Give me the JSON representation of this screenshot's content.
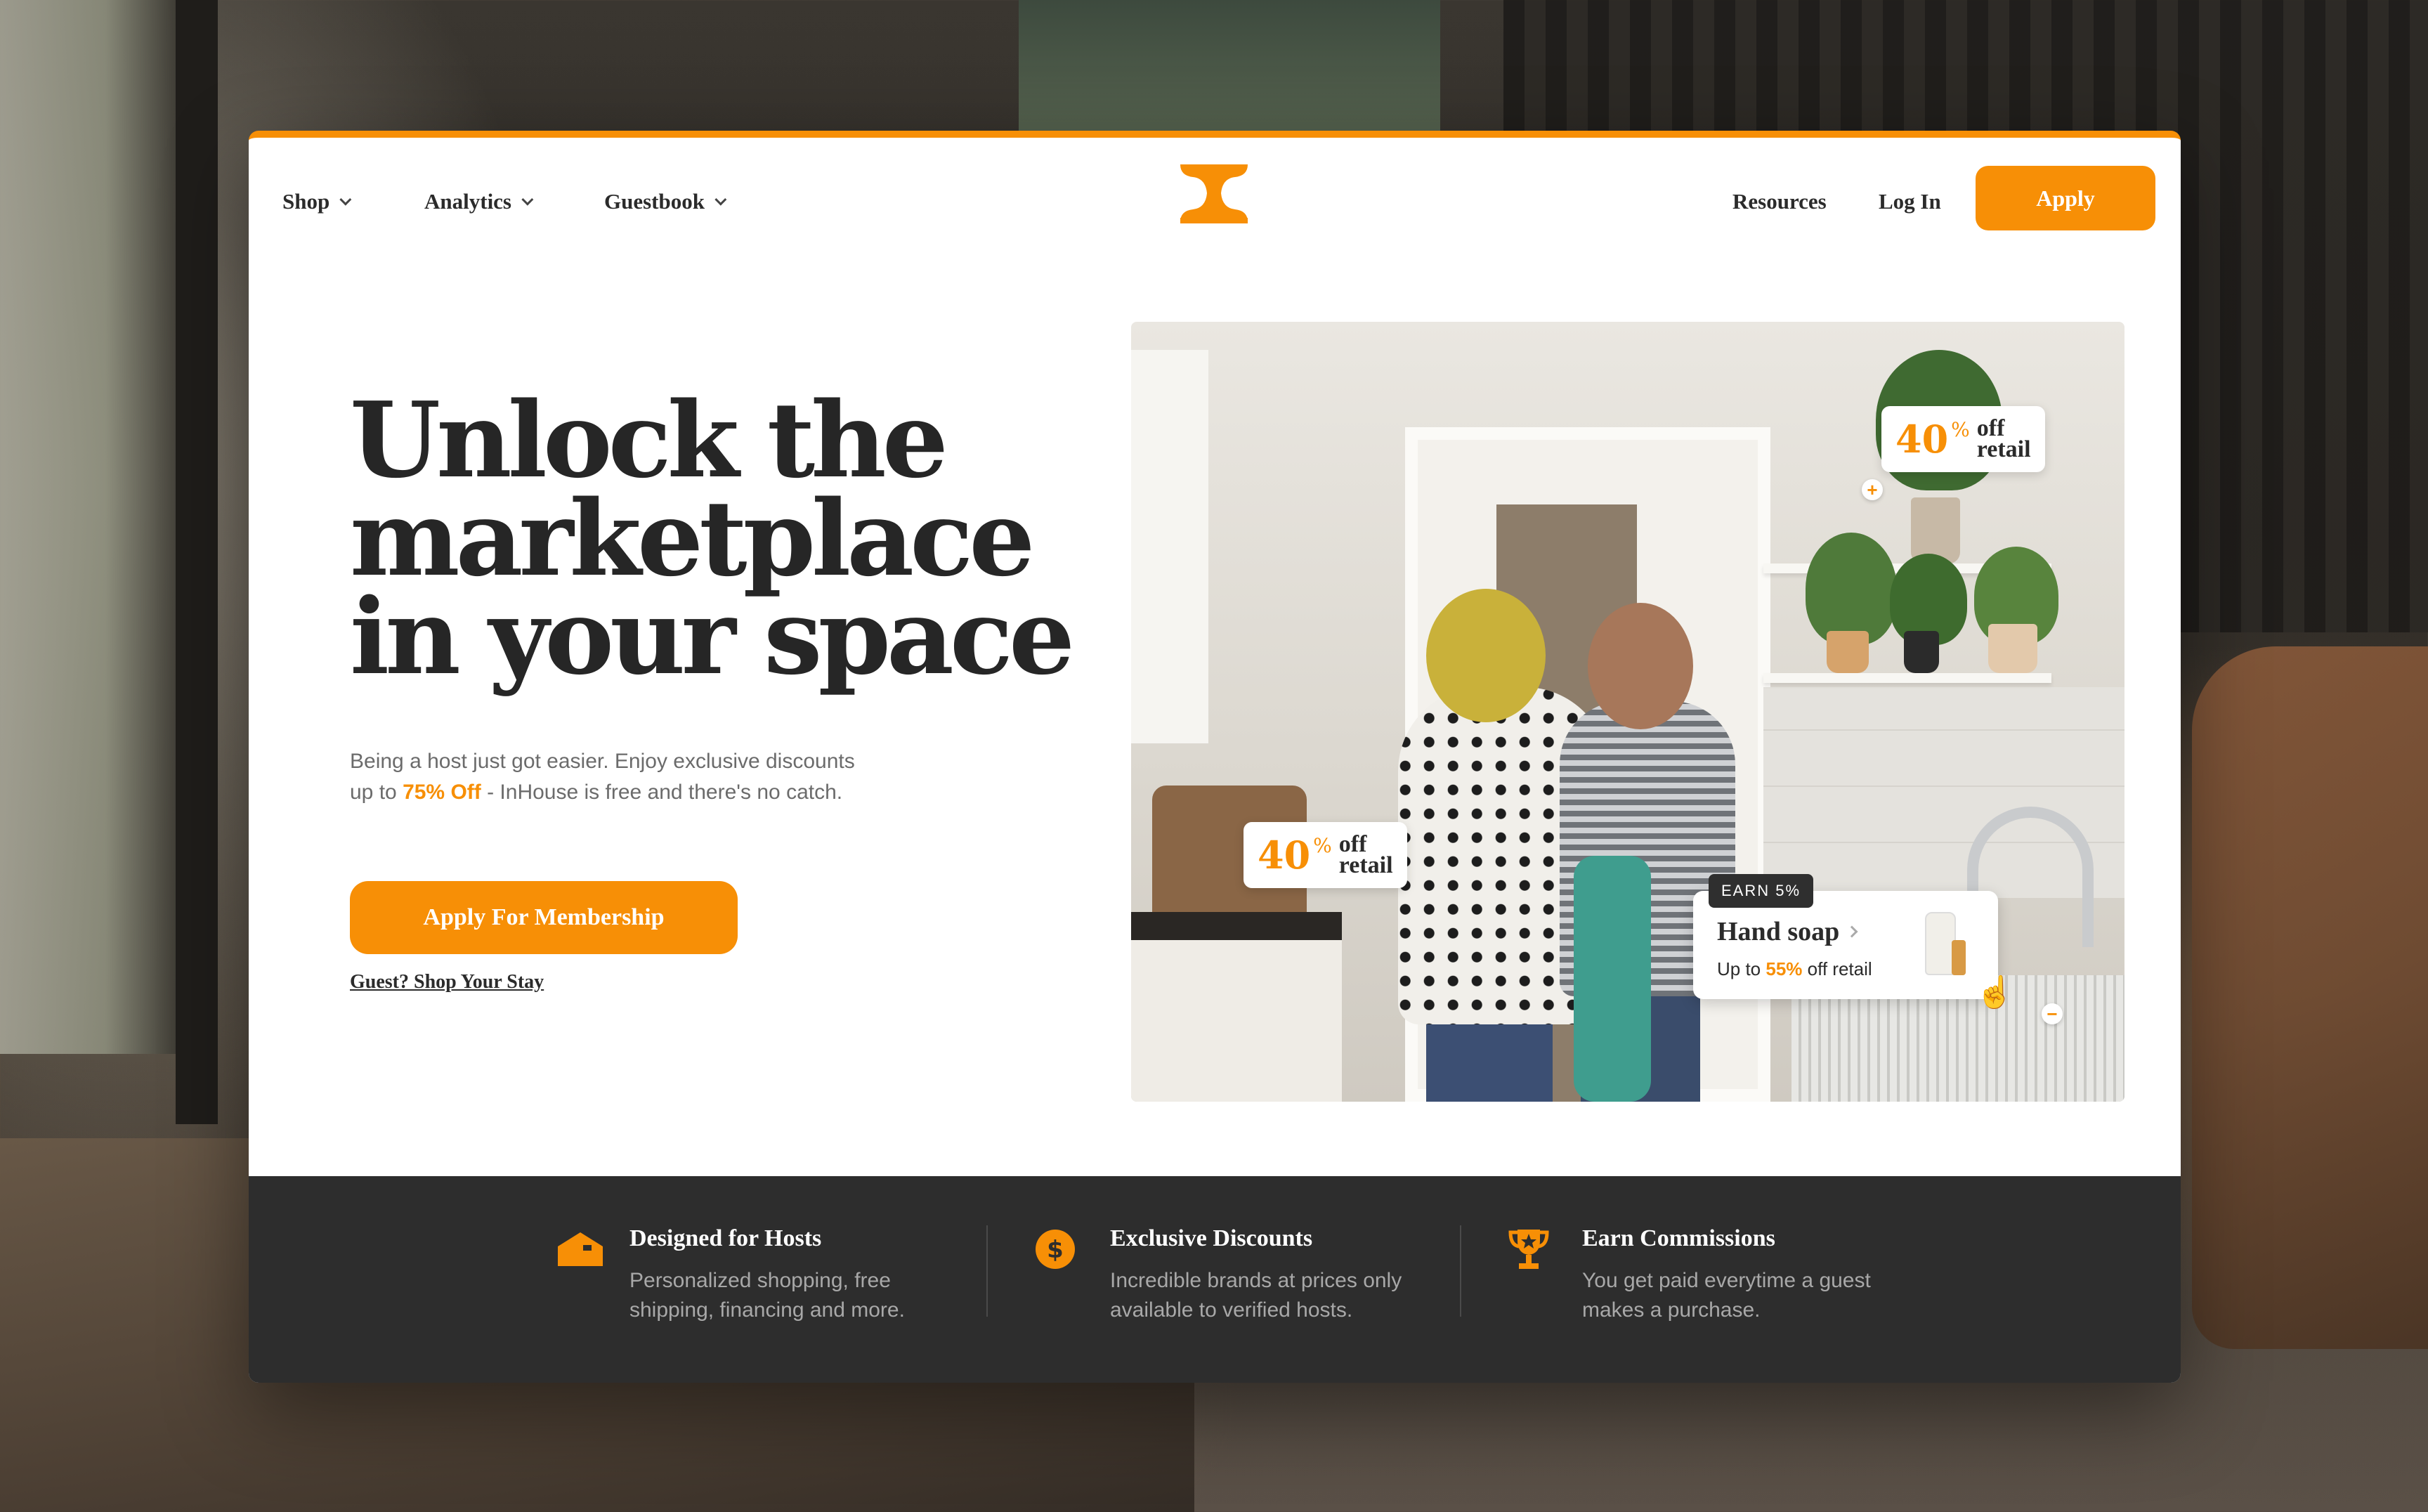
{
  "nav": {
    "left_items": [
      {
        "label": "Shop"
      },
      {
        "label": "Analytics"
      },
      {
        "label": "Guestbook"
      }
    ],
    "resources_label": "Resources",
    "login_label": "Log In",
    "apply_label": "Apply"
  },
  "hero": {
    "title_lines": [
      "Unlock the",
      "marketplace",
      "in your space"
    ],
    "subtitle_pre": "Being a host just got easier. Enjoy exclusive discounts up to ",
    "subtitle_highlight": "75% Off",
    "subtitle_post": " - InHouse is free and there's no catch.",
    "cta_label": "Apply For Membership",
    "guest_link": "Guest? Shop Your Stay"
  },
  "photo_overlays": {
    "badge_top": {
      "num": "40",
      "pct": "%",
      "off": "off",
      "retail": "retail"
    },
    "badge_left": {
      "num": "40",
      "pct": "%",
      "off": "off",
      "retail": "retail"
    },
    "earn_tag": "EARN 5%",
    "product": {
      "title": "Hand soap",
      "sub_pre": "Up to ",
      "sub_highlight": "55%",
      "sub_post": " off retail"
    }
  },
  "features": [
    {
      "title": "Designed  for Hosts",
      "desc": "Personalized shopping, free shipping, financing and more.",
      "icon": "house-icon"
    },
    {
      "title": "Exclusive Discounts",
      "desc": "Incredible brands at prices only available to verified hosts.",
      "icon": "dollar-icon"
    },
    {
      "title": "Earn Commissions",
      "desc": "You get paid everytime a guest makes a purchase.",
      "icon": "trophy-icon"
    }
  ],
  "colors": {
    "accent": "#f78f06",
    "dark": "#2d2d2d",
    "text": "#262626"
  }
}
